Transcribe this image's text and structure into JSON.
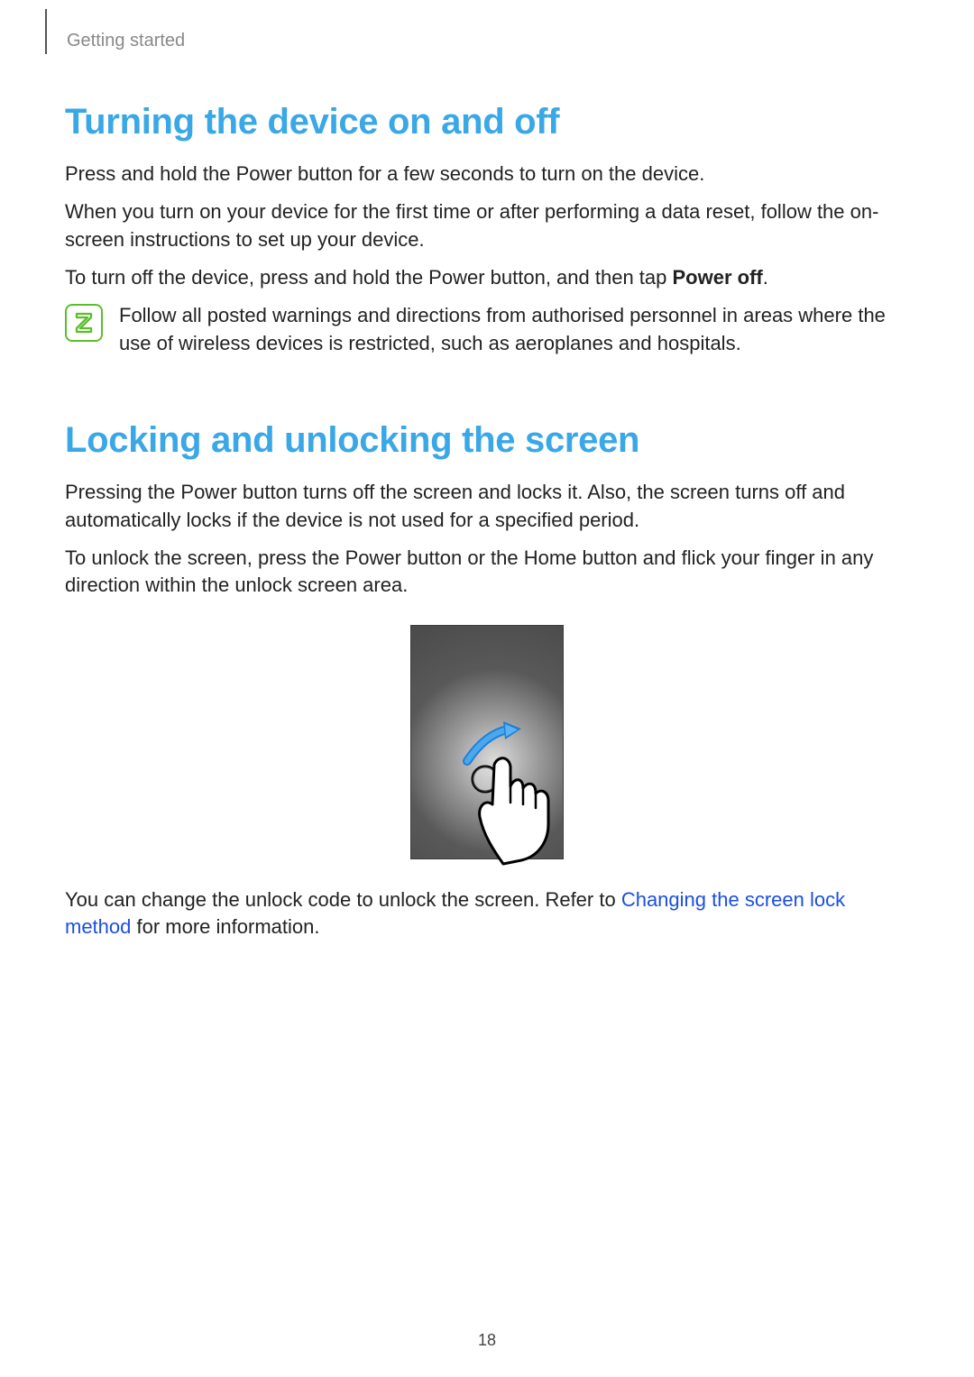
{
  "header": {
    "section": "Getting started"
  },
  "section1": {
    "title": "Turning the device on and off",
    "p1": "Press and hold the Power button for a few seconds to turn on the device.",
    "p2": "When you turn on your device for the first time or after performing a data reset, follow the on-screen instructions to set up your device.",
    "p3_pre": "To turn off the device, press and hold the Power button, and then tap ",
    "p3_bold": "Power off",
    "p3_post": ".",
    "note": "Follow all posted warnings and directions from authorised personnel in areas where the use of wireless devices is restricted, such as aeroplanes and hospitals."
  },
  "section2": {
    "title": "Locking and unlocking the screen",
    "p1": "Pressing the Power button turns off the screen and locks it. Also, the screen turns off and automatically locks if the device is not used for a specified period.",
    "p2": "To unlock the screen, press the Power button or the Home button and flick your finger in any direction within the unlock screen area.",
    "p3_pre": "You can change the unlock code to unlock the screen. Refer to ",
    "p3_link": "Changing the screen lock method",
    "p3_post": " for more information."
  },
  "page_number": "18"
}
